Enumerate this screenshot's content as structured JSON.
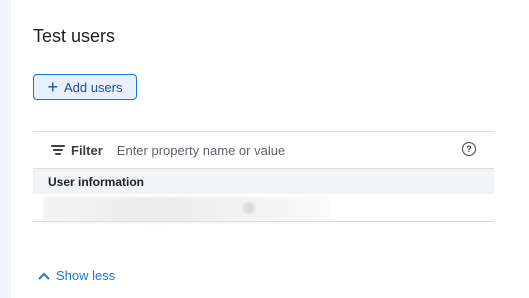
{
  "section": {
    "title": "Test users",
    "add_button_label": "Add users"
  },
  "filter": {
    "label": "Filter",
    "placeholder": "Enter property name or value",
    "help_icon": "?"
  },
  "table": {
    "columns": [
      "User information"
    ],
    "rows": [
      {
        "user_information": ""
      }
    ]
  },
  "footer": {
    "show_less_label": "Show less"
  },
  "colors": {
    "accent": "#1a73e8",
    "button_bg": "#e8f0fe",
    "header_bg": "#f1f3f4",
    "divider": "#dadce0"
  },
  "icons": {
    "add": "plus-icon",
    "filter": "filter-icon",
    "help": "help-circle-icon",
    "collapse": "chevron-up-icon"
  }
}
